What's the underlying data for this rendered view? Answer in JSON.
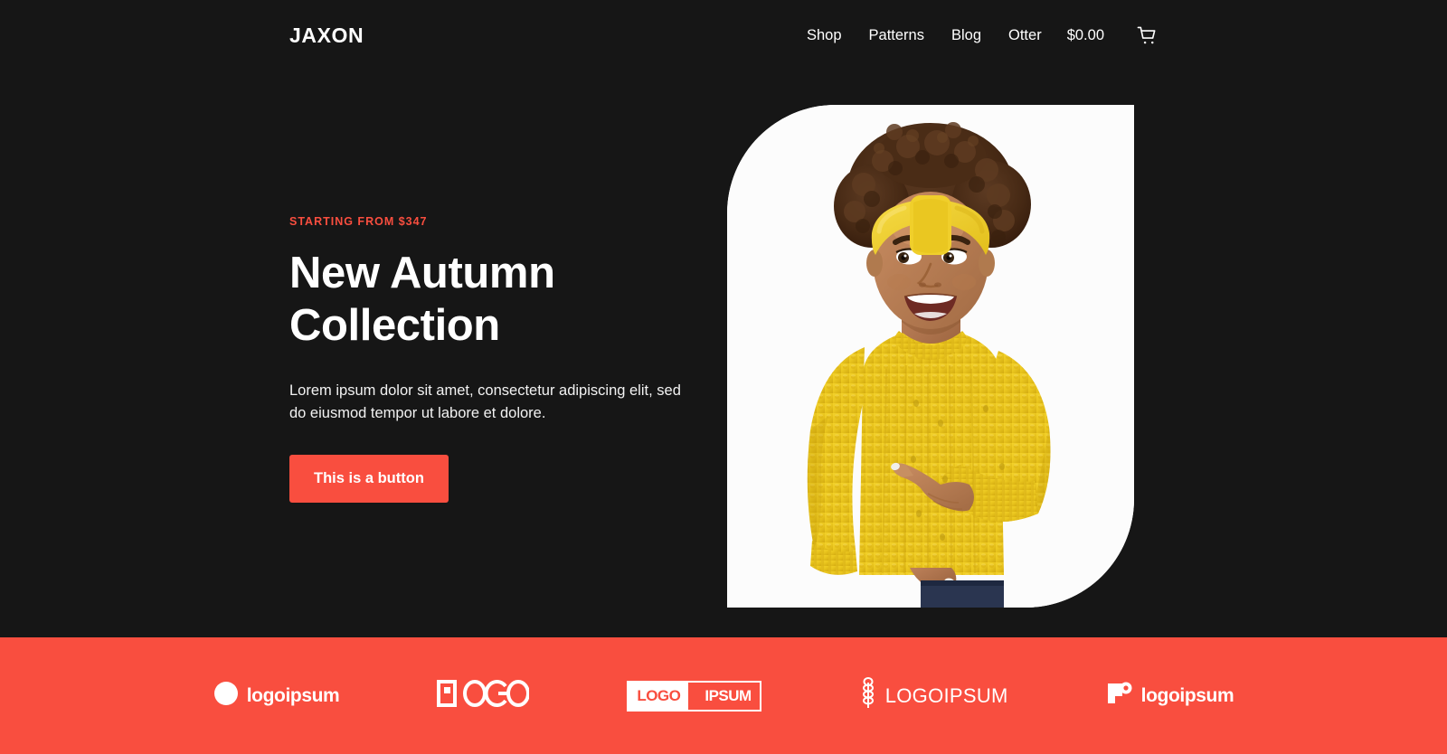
{
  "site": {
    "brand": "JAXON",
    "accent_color": "#F94E3F",
    "background_color": "#161616",
    "card_color": "#FFFFFF"
  },
  "header": {
    "logo": "JAXON",
    "nav": [
      {
        "label": "Shop"
      },
      {
        "label": "Patterns"
      },
      {
        "label": "Blog"
      },
      {
        "label": "Otter"
      }
    ],
    "cart_total": "$0.00",
    "cart_icon": "shopping-cart-icon"
  },
  "hero": {
    "eyebrow": "STARTING FROM $347",
    "headline": "New Autumn Collection",
    "subcopy": "Lorem ipsum dolor sit amet, consectetur adipiscing elit, sed do eiusmod tempor ut labore et dolore.",
    "cta_label": "This is a button",
    "image_alt": "Smiling woman with afro hair and yellow headband wearing a yellow knit sweater, pointing at herself"
  },
  "logo_bar": {
    "logos": [
      {
        "name": "logoipsum-circle-split",
        "text": "logoipsum",
        "mark": "circle-split-icon"
      },
      {
        "name": "logo-geometric",
        "text": "LOGO",
        "mark": "geometric-letters-icon"
      },
      {
        "name": "logo-ipsum-box",
        "text_a": "LOGO",
        "text_b": "IPSUM",
        "mark": "boxed-inverse-icon"
      },
      {
        "name": "logoipsum-wheat",
        "text": "LOGOIPSUM",
        "mark": "wheat-icon"
      },
      {
        "name": "logoipsum-square-dot",
        "text": "logoipsum",
        "mark": "square-circle-icon"
      }
    ]
  }
}
